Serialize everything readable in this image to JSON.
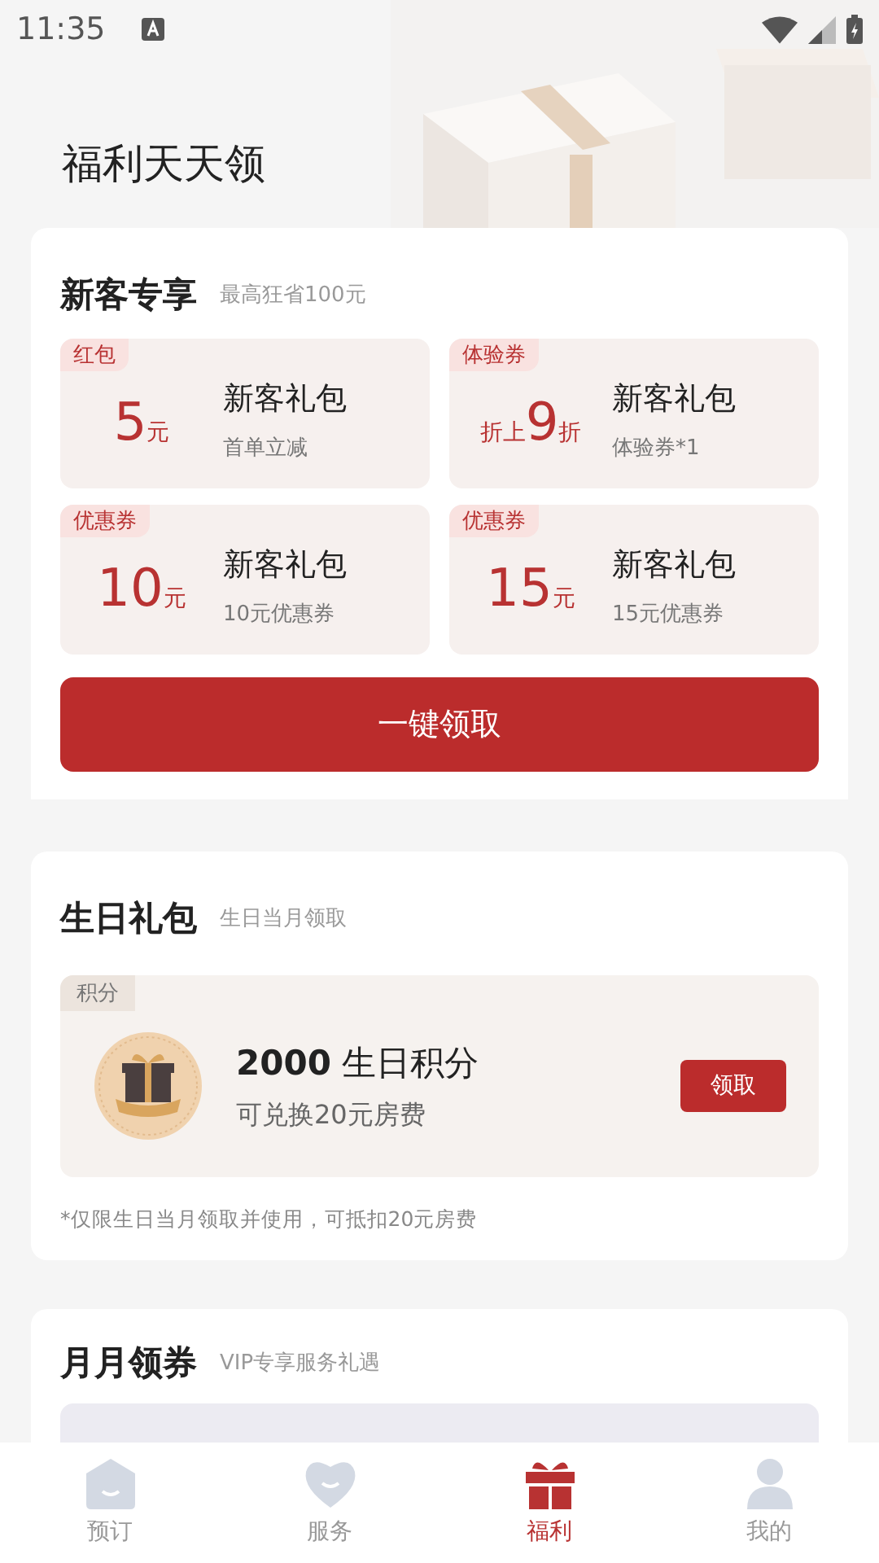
{
  "status_bar": {
    "time": "11:35"
  },
  "header": {
    "title": "福利天天领"
  },
  "new_customer": {
    "title": "新客专享",
    "subtitle": "最高狂省100元",
    "coupons": [
      {
        "tag": "红包",
        "value": "5",
        "unit": "元",
        "name": "新客礼包",
        "desc": "首单立减"
      },
      {
        "tag": "体验券",
        "prefix": "折上",
        "value": "9",
        "unit": "折",
        "name": "新客礼包",
        "desc": "体验券*1"
      },
      {
        "tag": "优惠券",
        "value": "10",
        "unit": "元",
        "name": "新客礼包",
        "desc": "10元优惠券"
      },
      {
        "tag": "优惠券",
        "value": "15",
        "unit": "元",
        "name": "新客礼包",
        "desc": "15元优惠券"
      }
    ],
    "claim_button": "一键领取"
  },
  "birthday": {
    "title": "生日礼包",
    "subtitle": "生日当月领取",
    "tag": "积分",
    "points": "2000",
    "points_label": "生日积分",
    "desc": "可兑换20元房费",
    "button": "领取",
    "note": "*仅限生日当月领取并使用，可抵扣20元房费"
  },
  "monthly": {
    "title": "月月领券",
    "subtitle": "VIP专享服务礼遇"
  },
  "tab_bar": [
    {
      "label": "预订",
      "kind": "house",
      "selected": false
    },
    {
      "label": "服务",
      "kind": "heart",
      "selected": false
    },
    {
      "label": "福利",
      "kind": "gift",
      "selected": true
    },
    {
      "label": "我的",
      "kind": "person",
      "selected": false
    }
  ]
}
